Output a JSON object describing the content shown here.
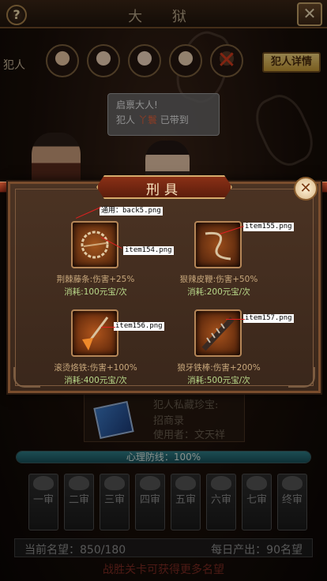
{
  "header": {
    "title": "大 狱",
    "help_glyph": "?",
    "close_glyph": "✕"
  },
  "prisoners": {
    "label": "犯人",
    "details_button": "犯人详情",
    "avatars": [
      {
        "name": "avatar-1",
        "skin": "#e8c6a2"
      },
      {
        "name": "avatar-2",
        "skin": "#efd2b6"
      },
      {
        "name": "avatar-3",
        "skin": "#f0d6be"
      },
      {
        "name": "avatar-4",
        "skin": "#ecd0b2"
      },
      {
        "name": "avatar-5",
        "skin": "#5a3a28"
      }
    ],
    "cross_glyph": "✕"
  },
  "speech": {
    "line1": "启禀大人!",
    "line2_prefix": "犯人",
    "line2_name": "丫鬟",
    "line2_suffix": "已带到"
  },
  "modal": {
    "title": "刑具",
    "close_glyph": "✕",
    "items": [
      {
        "name": "荆棘藤条:伤害+25%",
        "cost": "消耗:100元宝/次",
        "tint": "#7a3a14"
      },
      {
        "name": "狠辣皮鞭:伤害+50%",
        "cost": "消耗:200元宝/次",
        "tint": "#6e3414"
      },
      {
        "name": "滚烫烙铁:伤害+100%",
        "cost": "消耗:400元宝/次",
        "tint": "#8a3a12"
      },
      {
        "name": "狼牙铁棒:伤害+200%",
        "cost": "消耗:500元宝/次",
        "tint": "#7c3512"
      }
    ]
  },
  "debug_labels": {
    "general": "通用：back5.png",
    "item1": "item154.png",
    "item2": "item155.png",
    "item3": "item156.png",
    "item4": "item157.png"
  },
  "book": {
    "line1": "犯人私藏珍宝:",
    "line2": "招商录",
    "line3": "使用者：文天祥"
  },
  "defense": {
    "label": "心理防线：100%",
    "percent": 100
  },
  "ranks": [
    "一审",
    "二审",
    "三审",
    "四审",
    "五审",
    "六审",
    "七审",
    "终审"
  ],
  "stats": {
    "current": "当前名望：850/180",
    "daily": "每日产出：90名望"
  },
  "footer_hint": "战胜关卡可获得更多名望",
  "colors": {
    "accent": "#c39634",
    "modal_border": "#7a4d2d",
    "rail": "#c2512e"
  }
}
